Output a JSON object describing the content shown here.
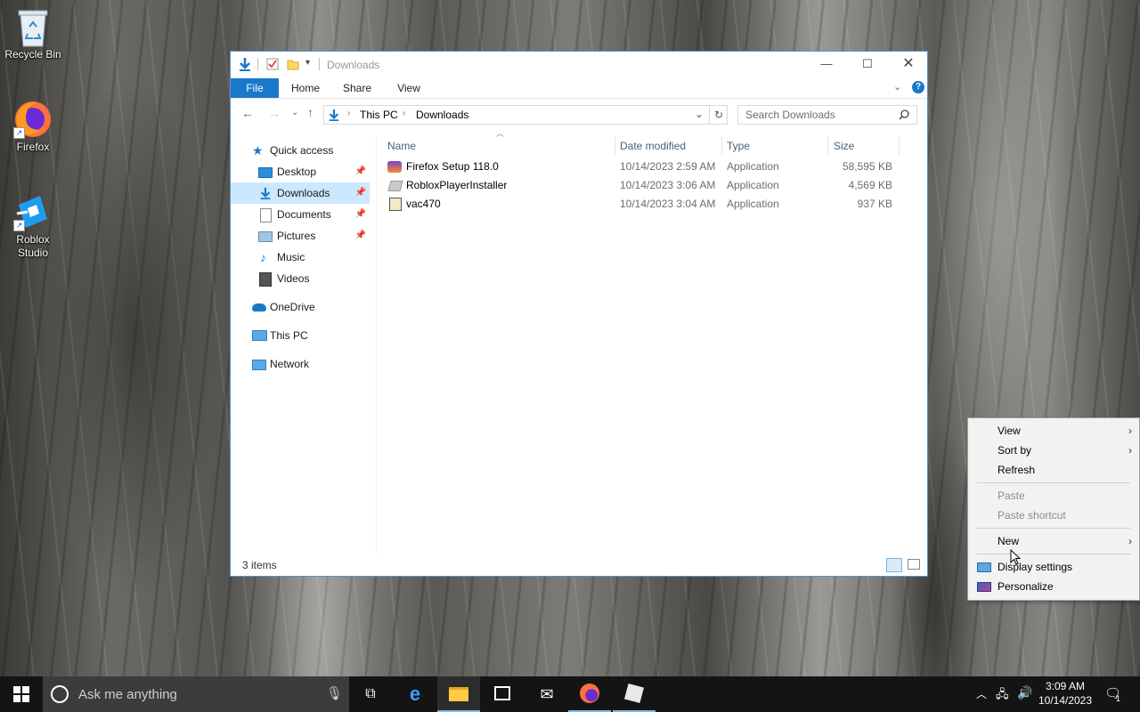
{
  "desktop": {
    "icons": [
      {
        "label": "Recycle Bin"
      },
      {
        "label": "Firefox"
      },
      {
        "label": "Roblox Studio"
      }
    ]
  },
  "explorer": {
    "title": "Downloads",
    "ribbon_tabs": [
      "File",
      "Home",
      "Share",
      "View"
    ],
    "breadcrumb": [
      "This PC",
      "Downloads"
    ],
    "search_placeholder": "Search Downloads",
    "sidebar": [
      {
        "label": "Quick access"
      },
      {
        "label": "Desktop",
        "pinned": true
      },
      {
        "label": "Downloads",
        "pinned": true,
        "selected": true
      },
      {
        "label": "Documents",
        "pinned": true
      },
      {
        "label": "Pictures",
        "pinned": true
      },
      {
        "label": "Music"
      },
      {
        "label": "Videos"
      },
      {
        "label": "OneDrive"
      },
      {
        "label": "This PC"
      },
      {
        "label": "Network"
      }
    ],
    "columns": [
      "Name",
      "Date modified",
      "Type",
      "Size"
    ],
    "files": [
      {
        "name": "Firefox Setup 118.0",
        "date": "10/14/2023 2:59 AM",
        "type": "Application",
        "size": "58,595 KB"
      },
      {
        "name": "RobloxPlayerInstaller",
        "date": "10/14/2023 3:06 AM",
        "type": "Application",
        "size": "4,569 KB"
      },
      {
        "name": "vac470",
        "date": "10/14/2023 3:04 AM",
        "type": "Application",
        "size": "937 KB"
      }
    ],
    "status": "3 items"
  },
  "context_menu": {
    "items": [
      {
        "label": "View",
        "submenu": true,
        "enabled": true
      },
      {
        "label": "Sort by",
        "submenu": true,
        "enabled": true
      },
      {
        "label": "Refresh",
        "submenu": false,
        "enabled": true
      },
      {
        "label": "Paste",
        "submenu": false,
        "enabled": false
      },
      {
        "label": "Paste shortcut",
        "submenu": false,
        "enabled": false
      },
      {
        "label": "New",
        "submenu": true,
        "enabled": true
      },
      {
        "label": "Display settings",
        "submenu": false,
        "enabled": true,
        "icon": "display-icon"
      },
      {
        "label": "Personalize",
        "submenu": false,
        "enabled": true,
        "icon": "personalize-icon"
      }
    ]
  },
  "taskbar": {
    "search_placeholder": "Ask me anything",
    "time": "3:09 AM",
    "date": "10/14/2023",
    "notification_count": "1"
  },
  "colors": {
    "accent": "#1979ca",
    "selection": "#cce8ff",
    "taskbar": "#141414"
  }
}
